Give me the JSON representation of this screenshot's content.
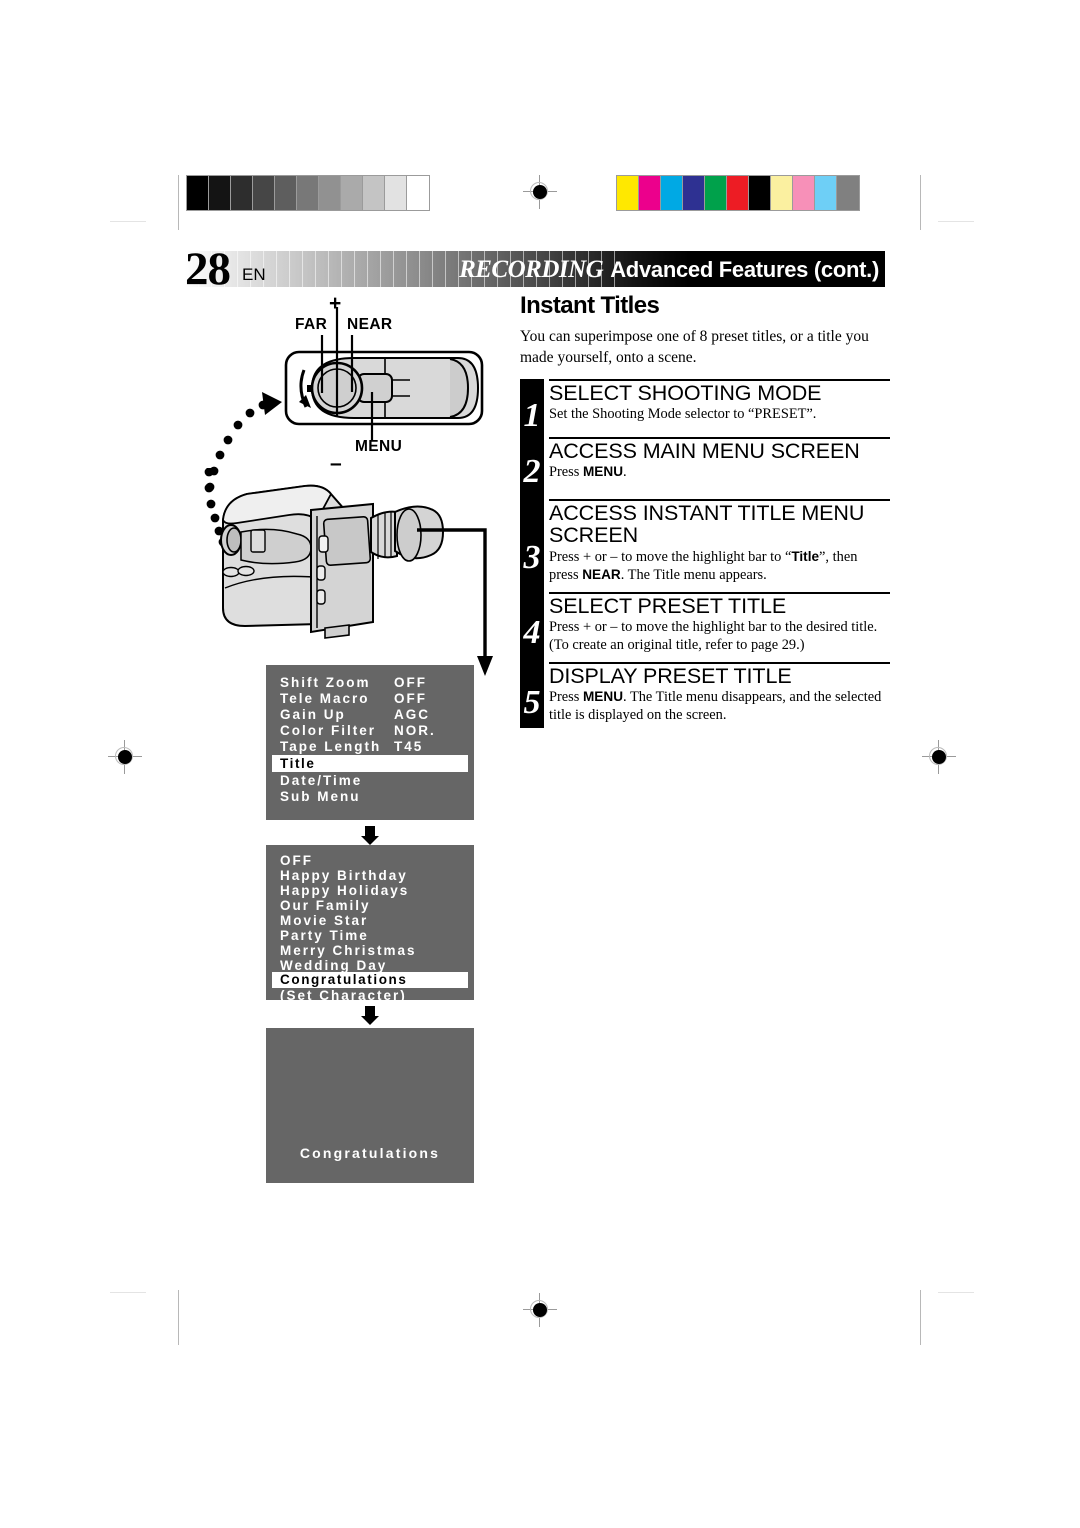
{
  "header": {
    "page_number": "28",
    "page_locale": "EN",
    "title_italic": "RECORDING",
    "title_rest": "Advanced Features (cont.)"
  },
  "section": {
    "title": "Instant Titles",
    "intro": "You can superimpose one of 8 preset titles, or a title you made yourself, onto a scene."
  },
  "steps": [
    {
      "number": "1",
      "heading": "SELECT SHOOTING MODE",
      "body_html": "Set the Shooting Mode selector to “PRESET”."
    },
    {
      "number": "2",
      "heading": "ACCESS MAIN MENU SCREEN",
      "body_html": "Press <b>MENU</b>."
    },
    {
      "number": "3",
      "heading": "ACCESS INSTANT TITLE MENU SCREEN",
      "body_html": "Press + or – to move the highlight bar to “<b>Title</b>”, then press <b>NEAR</b>. The Title menu appears."
    },
    {
      "number": "4",
      "heading": "SELECT PRESET TITLE",
      "body_html": "Press + or – to move the highlight bar to the desired title. (To create an original title, refer to page 29.)"
    },
    {
      "number": "5",
      "heading": "DISPLAY PRESET TITLE",
      "body_html": "Press <b>MENU</b>. The Title menu disappears, and the selected title is displayed on the screen."
    }
  ],
  "dial_labels": {
    "plus": "+",
    "minus": "–",
    "far": "FAR",
    "near": "NEAR",
    "menu": "MENU"
  },
  "osd_main_menu": {
    "rows": [
      {
        "label": "Shift Zoom",
        "value": "OFF"
      },
      {
        "label": "Tele Macro",
        "value": "OFF"
      },
      {
        "label": "Gain Up",
        "value": "AGC"
      },
      {
        "label": "Color Filter",
        "value": "NOR."
      },
      {
        "label": "Tape Length",
        "value": "T45"
      }
    ],
    "highlighted": "Title",
    "rows_after": [
      {
        "label": "Date/Time",
        "value": ""
      },
      {
        "label": "Sub Menu",
        "value": ""
      }
    ]
  },
  "osd_title_menu": {
    "items": [
      "OFF",
      "Happy Birthday",
      "Happy Holidays",
      "Our Family",
      "Movie Star",
      "Party Time",
      "Merry Christmas",
      "Wedding Day"
    ],
    "highlighted": "Congratulations",
    "items_after": [
      "(Set Character)"
    ]
  },
  "osd_result": {
    "title_text": "Congratulations"
  },
  "print_marks": {
    "grayscale_swatches": [
      "#000000",
      "#141414",
      "#2d2d2d",
      "#464646",
      "#5e5e5e",
      "#787878",
      "#919191",
      "#aaaaaa",
      "#c4c4c4",
      "#e2e2e2",
      "#ffffff"
    ],
    "color_swatches": [
      "#ffe800",
      "#ec008c",
      "#00a9e4",
      "#2e3192",
      "#00a14b",
      "#ed1c24",
      "#000000",
      "#fbf0a0",
      "#f790b8",
      "#6ecff6",
      "#808080"
    ]
  },
  "colors": {
    "osd_background": "#666666",
    "osd_text": "#ffffff",
    "highlight_background": "#ffffff",
    "highlight_text": "#000000",
    "ink": "#000000"
  }
}
